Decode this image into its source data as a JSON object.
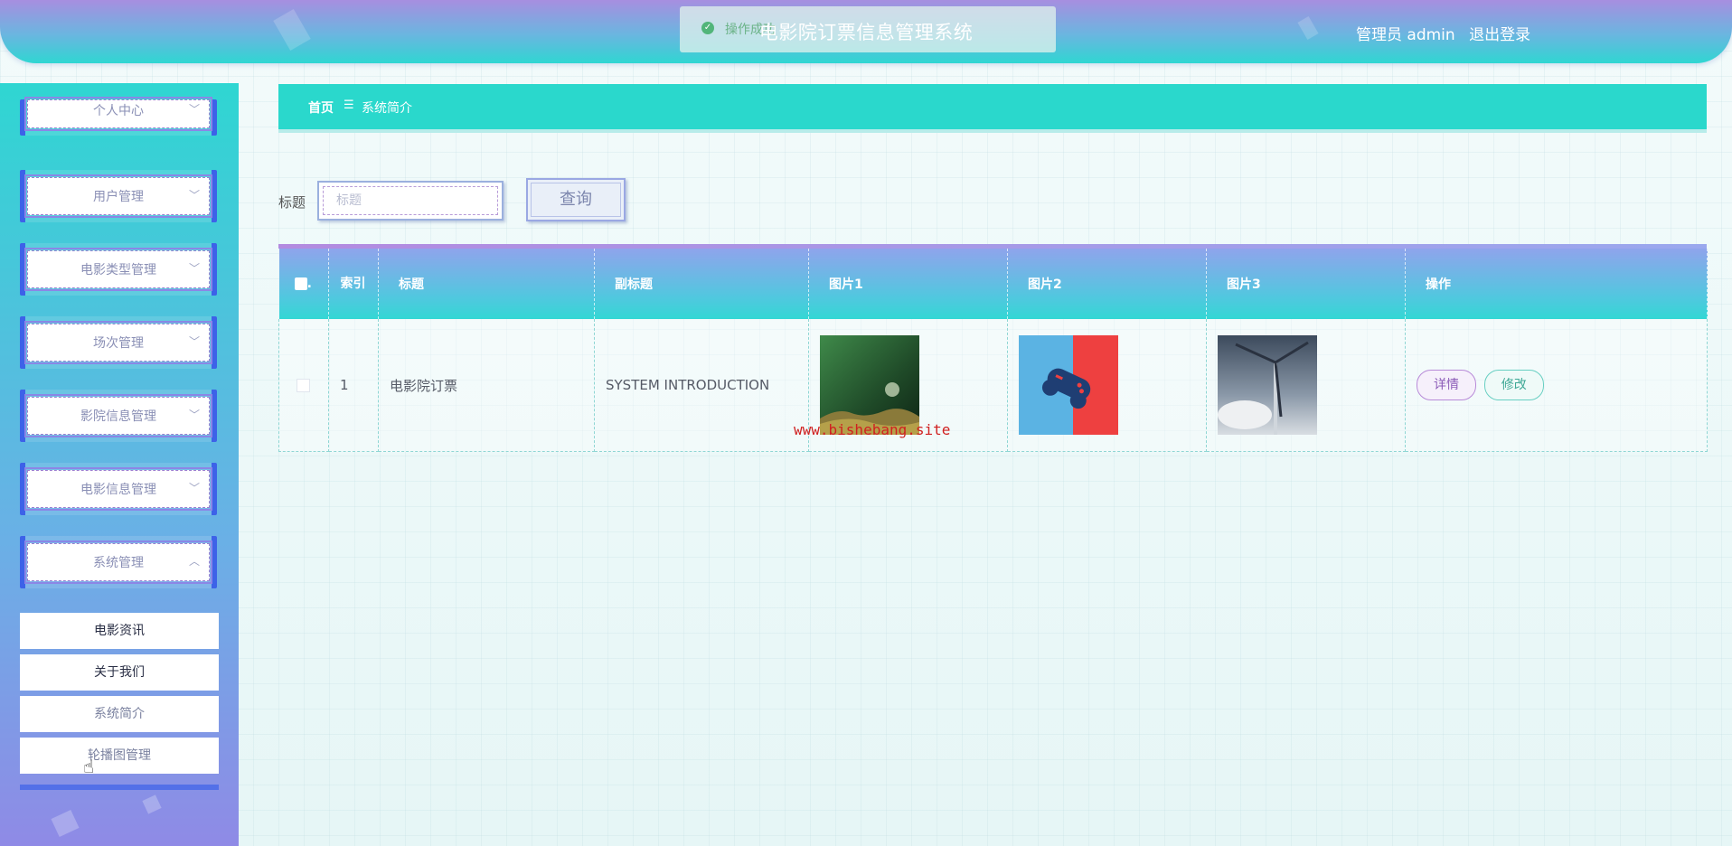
{
  "header": {
    "title": "电影院订票信息管理系统",
    "toast_text": "操作成功",
    "user_label": "管理员 admin",
    "logout_label": "退出登录"
  },
  "sidebar": {
    "menus": [
      {
        "label": "个人中心",
        "chevron": "chevron-down-icon"
      },
      {
        "label": "用户管理",
        "chevron": "chevron-down-icon"
      },
      {
        "label": "电影类型管理",
        "chevron": "chevron-down-icon"
      },
      {
        "label": "场次管理",
        "chevron": "chevron-down-icon"
      },
      {
        "label": "影院信息管理",
        "chevron": "chevron-down-icon"
      },
      {
        "label": "电影信息管理",
        "chevron": "chevron-down-icon"
      },
      {
        "label": "系统管理",
        "chevron": "chevron-up-icon"
      }
    ],
    "submenu": [
      {
        "label": "电影资讯"
      },
      {
        "label": "关于我们"
      },
      {
        "label": "系统简介"
      },
      {
        "label": "轮播图管理"
      }
    ]
  },
  "breadcrumb": {
    "home": "首页",
    "separator": "☰",
    "current": "系统简介"
  },
  "search": {
    "label": "标题",
    "placeholder": "标题",
    "value": "",
    "button_label": "查询"
  },
  "table": {
    "headers": {
      "index": "索引",
      "title": "标题",
      "subtitle": "副标题",
      "pic1": "图片1",
      "pic2": "图片2",
      "pic3": "图片3",
      "actions": "操作"
    },
    "rows": [
      {
        "index": "1",
        "title": "电影院订票",
        "subtitle": "SYSTEM INTRODUCTION",
        "pic1": "nature-grass-image",
        "pic2": "game-controller-image",
        "pic3": "wind-turbine-image",
        "detail_label": "详情",
        "edit_label": "修改"
      }
    ]
  },
  "watermark": "www.bishebang.site",
  "colors": {
    "accent": "#2ad8cc",
    "sidebar_border": "#3d62e8",
    "detail": "#8c5cb8",
    "edit": "#3fa896",
    "watermark": "#d02020"
  }
}
